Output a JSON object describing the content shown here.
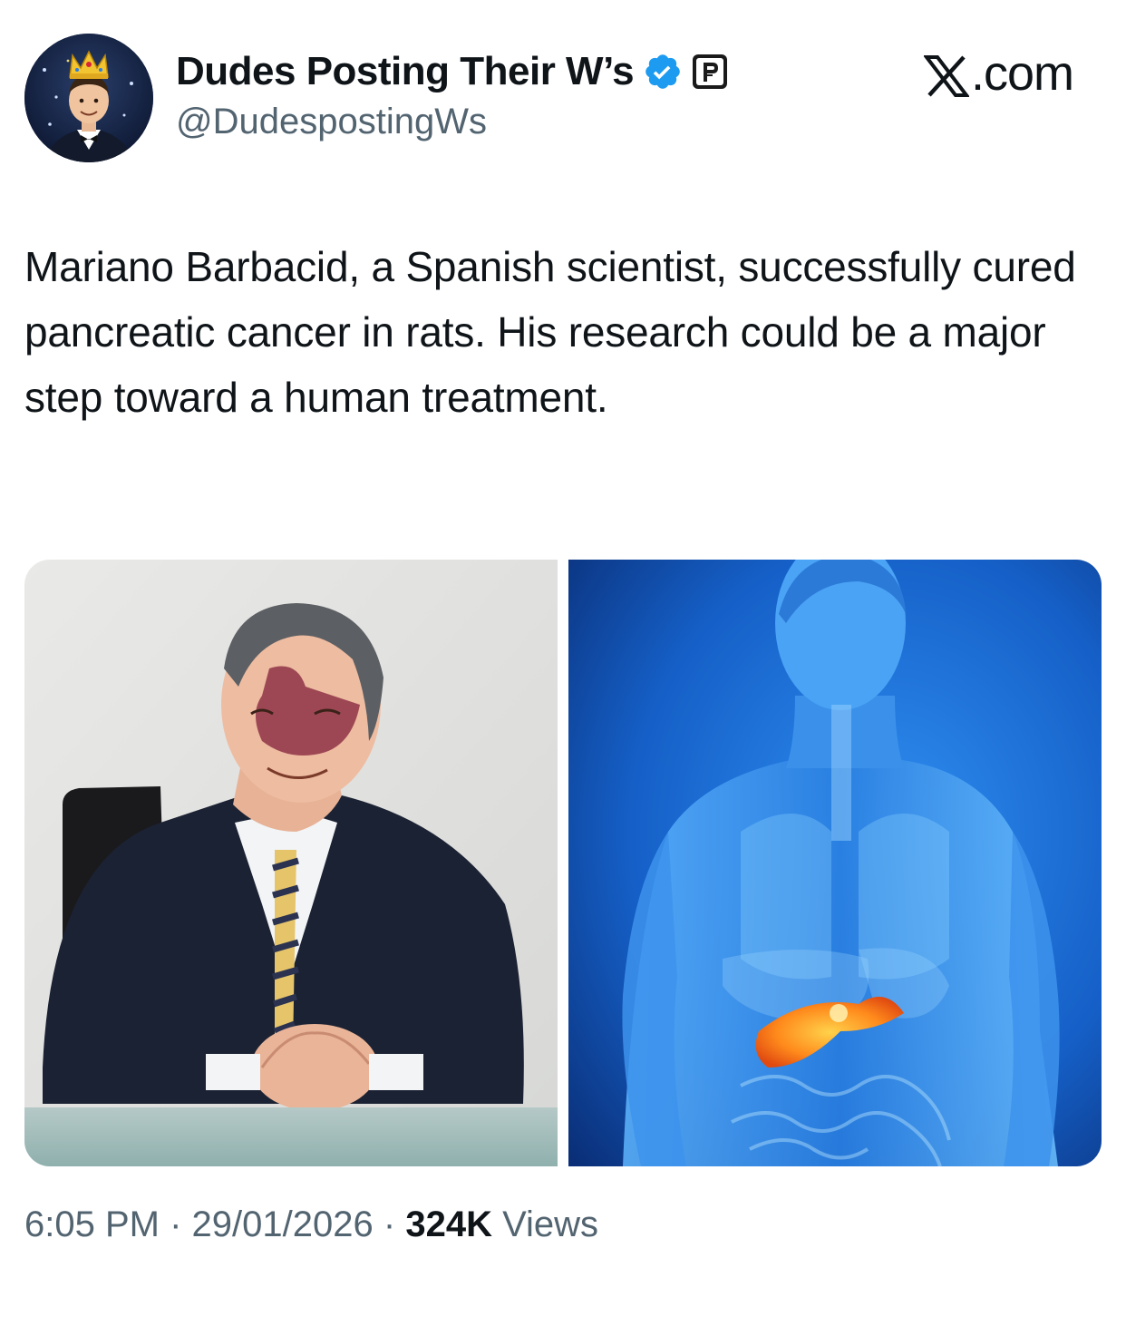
{
  "author": {
    "display_name": "Dudes Posting Their W’s",
    "handle": "@DudespostingWs",
    "verified_icon": "verified-check-icon",
    "affiliate_icon": "affiliate-p-icon",
    "avatar_icon": "crowned-man-avatar"
  },
  "site_label": {
    "suffix": ".com"
  },
  "tweet": {
    "text": "Mariano Barbacid, a Spanish scientist, successfully cured pancreatic cancer in rats. His research could be a major step toward a human treatment."
  },
  "media": {
    "images": [
      {
        "kind": "portrait-photo"
      },
      {
        "kind": "anatomy-illustration"
      }
    ]
  },
  "meta": {
    "time": "6:05 PM",
    "separator": "·",
    "date": "29/01/2026",
    "views_count": "324K",
    "views_label": "Views"
  },
  "colors": {
    "text_primary": "#0f1419",
    "text_secondary": "#536471",
    "verified_blue": "#1d9bf0",
    "illustration_blue": "#1560c8",
    "pancreas_orange": "#ff8a1c"
  }
}
